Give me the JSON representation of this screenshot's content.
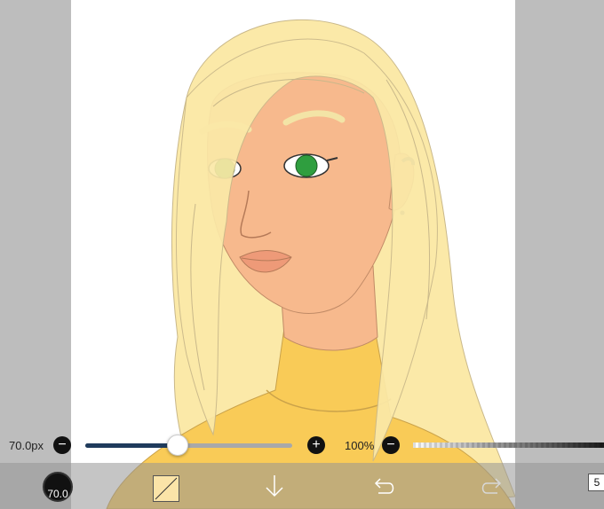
{
  "brush": {
    "size_label": "70.0px",
    "size_value": 70,
    "size_fraction": 0.44,
    "indicator_label": "70.0"
  },
  "opacity": {
    "label": "100%",
    "value": 100
  },
  "buttons": {
    "minus": "−",
    "plus": "+"
  },
  "toolbar": {
    "layers_count": "5",
    "icons": [
      "brush-size-icon",
      "color-swatch-icon",
      "download-arrow-icon",
      "undo-icon",
      "redo-icon",
      "layers-icon"
    ]
  },
  "colors": {
    "hair": "#fbe9a8",
    "skin": "#f7b98d",
    "sweater": "#f9cb57",
    "eyes": "#2f9e3f",
    "slider_fill": "#1f3b5c",
    "background": "#bdbdbd"
  }
}
